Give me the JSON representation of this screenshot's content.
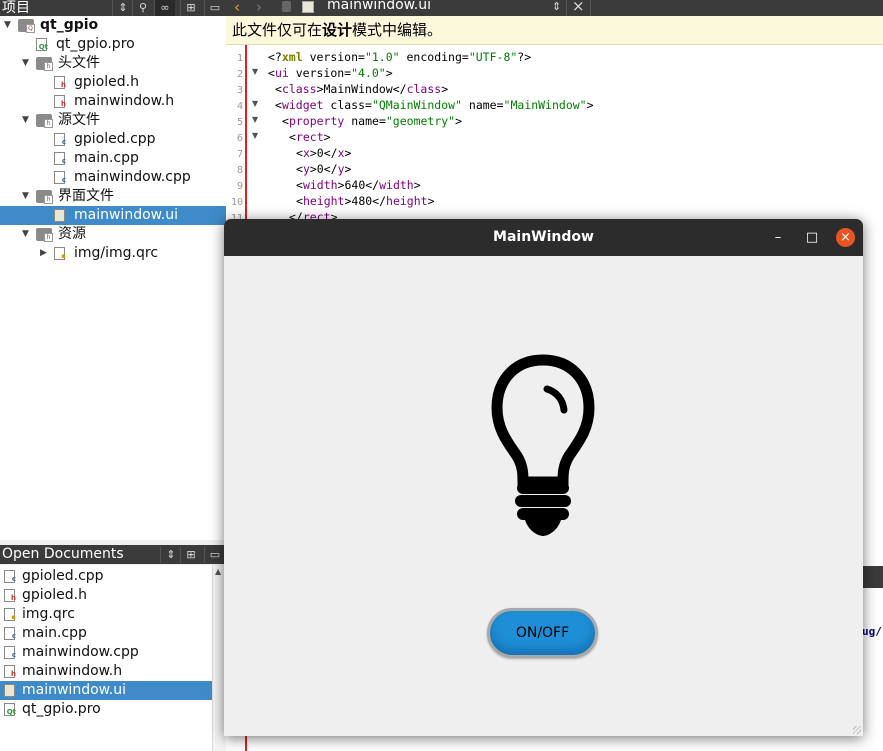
{
  "project_pane": {
    "header_title": "项目",
    "tree": [
      {
        "label": "qt_gpio",
        "kind": "project",
        "expanded": true,
        "level": 0,
        "bold": true
      },
      {
        "label": "qt_gpio.pro",
        "kind": "pro",
        "level": 1
      },
      {
        "label": "头文件",
        "kind": "folder",
        "expanded": true,
        "level": 1
      },
      {
        "label": "gpioled.h",
        "kind": "h",
        "level": 2
      },
      {
        "label": "mainwindow.h",
        "kind": "h",
        "level": 2
      },
      {
        "label": "源文件",
        "kind": "folder",
        "expanded": true,
        "level": 1
      },
      {
        "label": "gpioled.cpp",
        "kind": "cpp",
        "level": 2
      },
      {
        "label": "main.cpp",
        "kind": "cpp",
        "level": 2
      },
      {
        "label": "mainwindow.cpp",
        "kind": "cpp",
        "level": 2
      },
      {
        "label": "界面文件",
        "kind": "folder",
        "expanded": true,
        "level": 1
      },
      {
        "label": "mainwindow.ui",
        "kind": "ui",
        "level": 2,
        "selected": true
      },
      {
        "label": "资源",
        "kind": "folder",
        "expanded": true,
        "level": 1
      },
      {
        "label": "img/img.qrc",
        "kind": "qrc",
        "level": 2,
        "expanded": false
      }
    ]
  },
  "open_documents": {
    "header_title": "Open Documents",
    "items": [
      {
        "label": "gpioled.cpp",
        "kind": "cpp"
      },
      {
        "label": "gpioled.h",
        "kind": "h"
      },
      {
        "label": "img.qrc",
        "kind": "qrc"
      },
      {
        "label": "main.cpp",
        "kind": "cpp"
      },
      {
        "label": "mainwindow.cpp",
        "kind": "cpp"
      },
      {
        "label": "mainwindow.h",
        "kind": "h"
      },
      {
        "label": "mainwindow.ui",
        "kind": "ui",
        "selected": true
      },
      {
        "label": "qt_gpio.pro",
        "kind": "pro"
      }
    ]
  },
  "editor": {
    "tab_title": "mainwindow.ui",
    "info_bar_pre": "此文件仅可在",
    "info_bar_bold": "设计",
    "info_bar_post": "模式中编辑。",
    "line_numbers": [
      "1",
      "2",
      "3",
      "4",
      "5",
      "6",
      "7",
      "8",
      "9",
      "10",
      "11"
    ],
    "edge_text": "ug/"
  },
  "main_window": {
    "title": "MainWindow",
    "minimize_glyph": "–",
    "maximize_glyph": "□",
    "close_glyph": "×",
    "button_label": "ON/OFF",
    "bulb_state": "off",
    "icons": [
      "lightbulb-icon"
    ],
    "accent_color": "#1e8fd6",
    "close_color": "#e95420"
  }
}
